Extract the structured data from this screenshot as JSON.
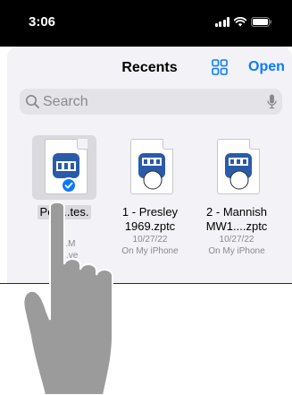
{
  "status": {
    "time": "3:06"
  },
  "header": {
    "title": "Recents",
    "open_label": "Open"
  },
  "search": {
    "placeholder": "Search"
  },
  "files": [
    {
      "name": "Pea...tes.",
      "date": "3/...M",
      "location": "iCl...ve",
      "selected": true
    },
    {
      "name_line1": "1 - Presley",
      "name_line2": "1969.zptc",
      "date": "10/27/22",
      "location": "On My iPhone"
    },
    {
      "name_line1": "2 - Mannish",
      "name_line2": "MW1....zptc",
      "date": "10/27/22",
      "location": "On My iPhone"
    }
  ],
  "colors": {
    "accent": "#0a7aff",
    "file_icon": "#2a5ba8",
    "hand": "#9b9b9b"
  },
  "icons": [
    "signal-icon",
    "wifi-icon",
    "battery-icon",
    "grid-view-icon",
    "search-icon",
    "microphone-icon",
    "checkmark-icon",
    "file-icon"
  ]
}
